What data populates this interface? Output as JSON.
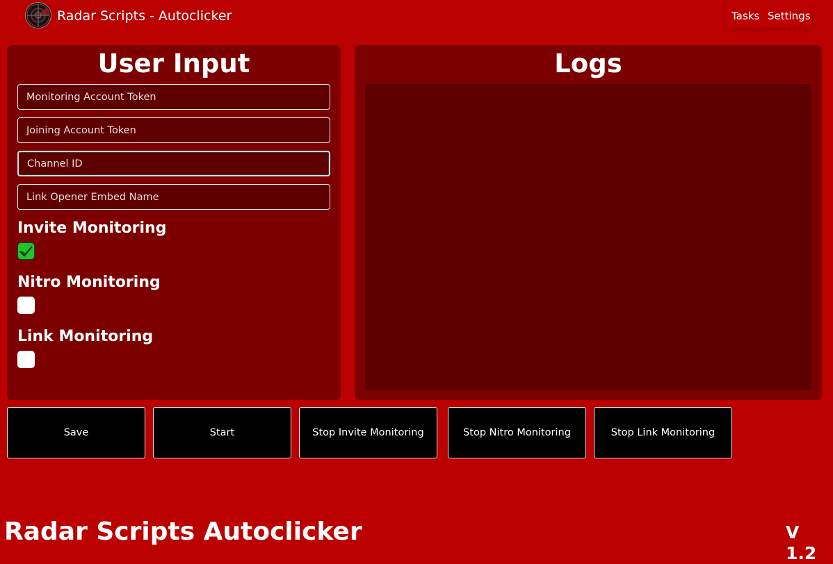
{
  "header": {
    "logo_icon": "radar-icon",
    "title": "Radar Scripts - Autoclicker",
    "nav": [
      {
        "label": "Tasks"
      },
      {
        "label": "Settings"
      }
    ]
  },
  "user_input": {
    "title": "User Input",
    "fields": [
      {
        "placeholder": "Monitoring Account Token",
        "value": ""
      },
      {
        "placeholder": "Joining Account Token",
        "value": ""
      },
      {
        "placeholder": "Channel ID",
        "value": "",
        "focused": true
      },
      {
        "placeholder": "Link Opener Embed Name",
        "value": ""
      }
    ],
    "toggles": [
      {
        "label": "Invite Monitoring",
        "checked": true
      },
      {
        "label": "Nitro Monitoring",
        "checked": false
      },
      {
        "label": "Link Monitoring",
        "checked": false
      }
    ]
  },
  "logs": {
    "title": "Logs",
    "entries": []
  },
  "actions": [
    {
      "label": "Save"
    },
    {
      "label": "Start"
    },
    {
      "label": "Stop Invite Monitoring"
    },
    {
      "label": "Stop Nitro Monitoring"
    },
    {
      "label": "Stop Link Monitoring"
    }
  ],
  "footer": {
    "title": "Radar Scripts Autoclicker",
    "version": "V 1.2"
  },
  "colors": {
    "background": "#bb0000",
    "panel": "#7d0000",
    "field": "#5e0000",
    "check": "#22c22a",
    "button": "#000000"
  }
}
